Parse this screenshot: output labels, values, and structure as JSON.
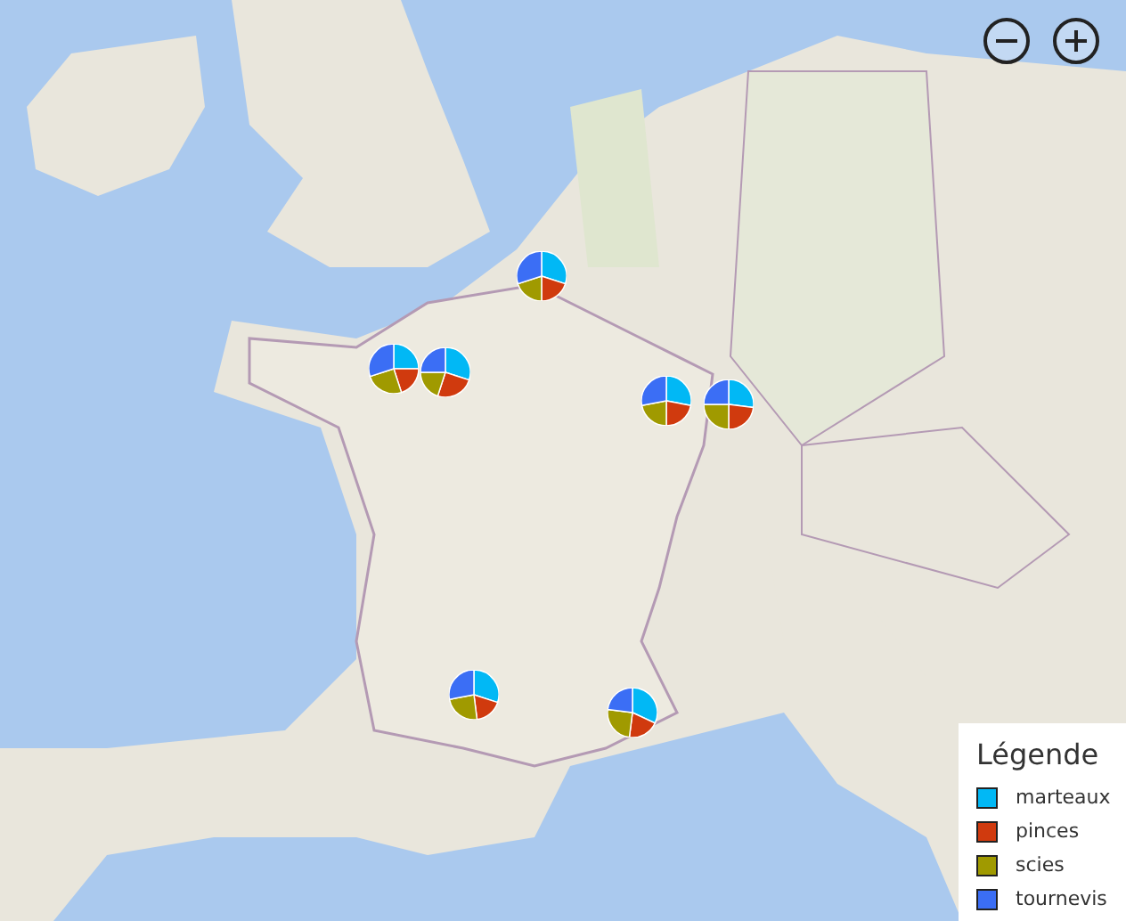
{
  "legend": {
    "title": "Légende",
    "items": [
      {
        "label": "marteaux",
        "color": "#01b8f5"
      },
      {
        "label": "pinces",
        "color": "#d03a0e"
      },
      {
        "label": "scies",
        "color": "#a09a00"
      },
      {
        "label": "tournevis",
        "color": "#3b6ef5"
      }
    ]
  }
}
